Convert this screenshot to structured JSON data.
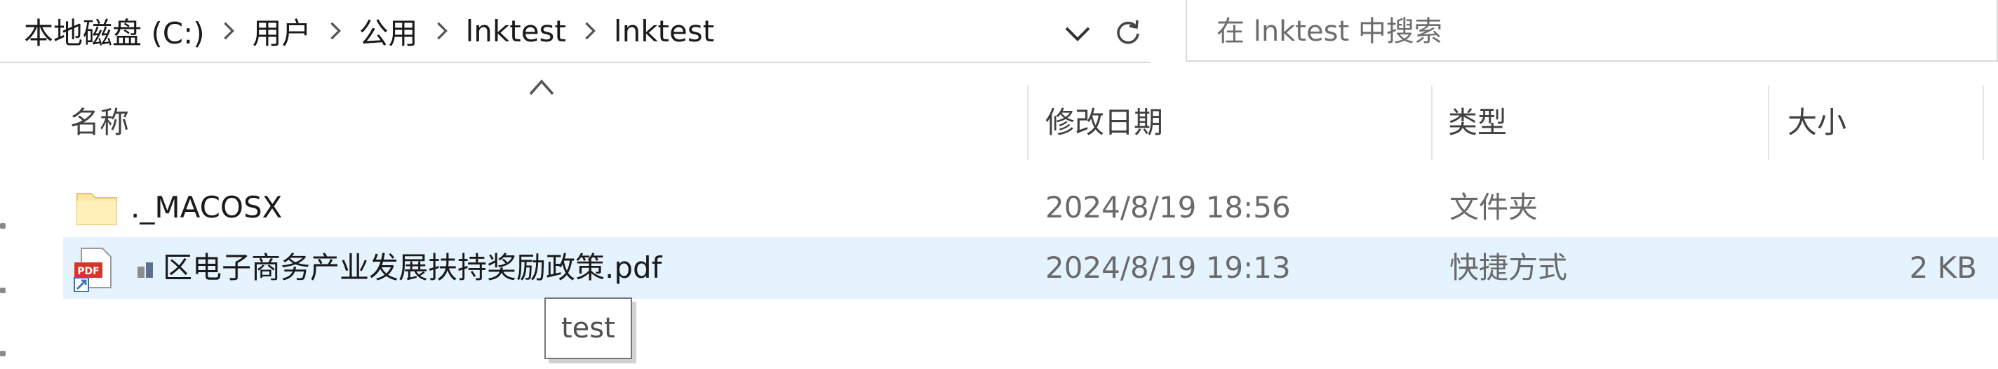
{
  "address_bar": {
    "crumbs": [
      "本地磁盘 (C:)",
      "用户",
      "公用",
      "lnktest",
      "lnktest"
    ]
  },
  "search": {
    "placeholder": "在 lnktest 中搜索"
  },
  "columns": {
    "name": "名称",
    "date": "修改日期",
    "type": "类型",
    "size": "大小"
  },
  "files": [
    {
      "name": "._MACOSX",
      "date": "2024/8/19 18:56",
      "type": "文件夹",
      "size": "",
      "icon": "folder-icon"
    },
    {
      "name": "区电子商务产业发展扶持奖励政策.pdf",
      "date": "2024/8/19 19:13",
      "type": "快捷方式",
      "size": "2 KB",
      "icon": "pdf-shortcut-icon"
    }
  ],
  "tooltip": {
    "text": "test"
  },
  "colors": {
    "selection": "#e5f3ff",
    "folder": "#ffe8a6",
    "pdf_red": "#d9342b"
  }
}
